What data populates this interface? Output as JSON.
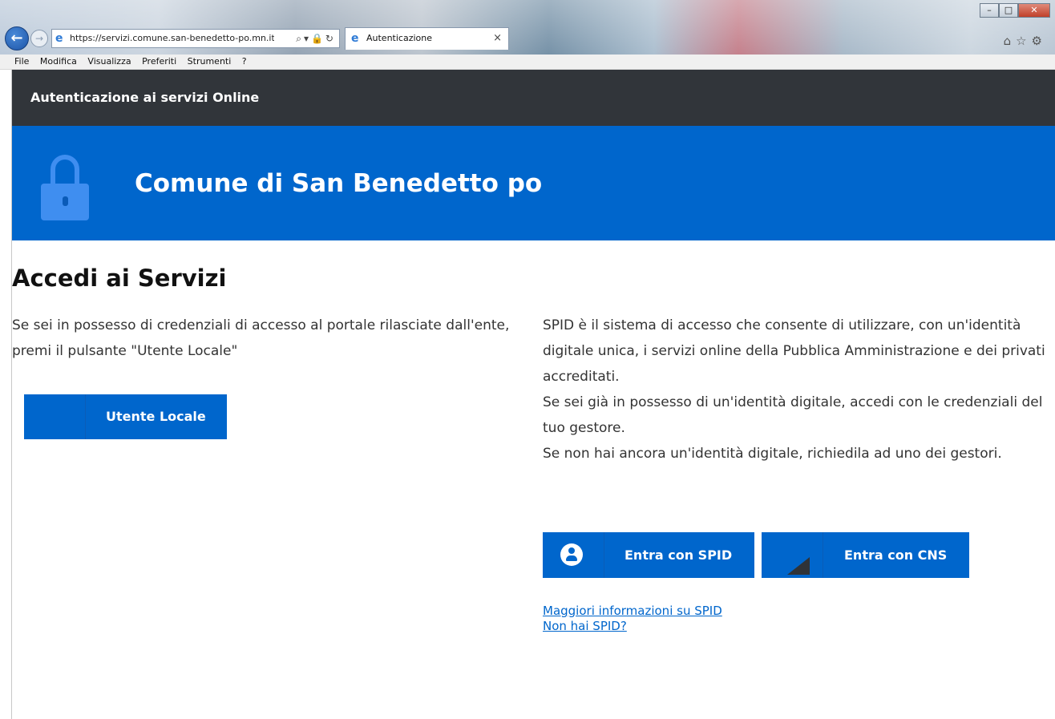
{
  "browser": {
    "url": "https://servizi.comune.san-benedetto-po.mn.it/",
    "tab_title": "Autenticazione",
    "tab_close": "×",
    "menu": [
      "File",
      "Modifica",
      "Visualizza",
      "Preferiti",
      "Strumenti",
      "?"
    ],
    "window_buttons": [
      "–",
      "□",
      "✕"
    ],
    "toolbar_icons": [
      "home-icon",
      "star-icon",
      "gear-icon"
    ]
  },
  "topbar": {
    "title": "Autenticazione ai servizi Online"
  },
  "hero": {
    "title": "Comune di San Benedetto po"
  },
  "main": {
    "heading": "Accedi ai Servizi",
    "left_text": "Se sei in possesso di credenziali di accesso al portale rilasciate dall'ente, premi il pulsante \"Utente Locale\"",
    "local_button": "Utente Locale",
    "right_text": [
      "SPID è il sistema di accesso che consente di utilizzare, con un'identità digitale unica, i servizi online della Pubblica Amministrazione e dei privati accreditati.",
      "Se sei già in possesso di un'identità digitale, accedi con le credenziali del tuo gestore.",
      "Se non hai ancora un'identità digitale, richiedila ad uno dei gestori."
    ],
    "spid_button": "Entra con SPID",
    "cns_button": "Entra con CNS",
    "link_more_info": "Maggiori informazioni su SPID",
    "link_no_spid": "Non hai SPID?"
  },
  "colors": {
    "primary": "#0066cc",
    "topbar": "#31353a",
    "link": "#0066cc"
  }
}
